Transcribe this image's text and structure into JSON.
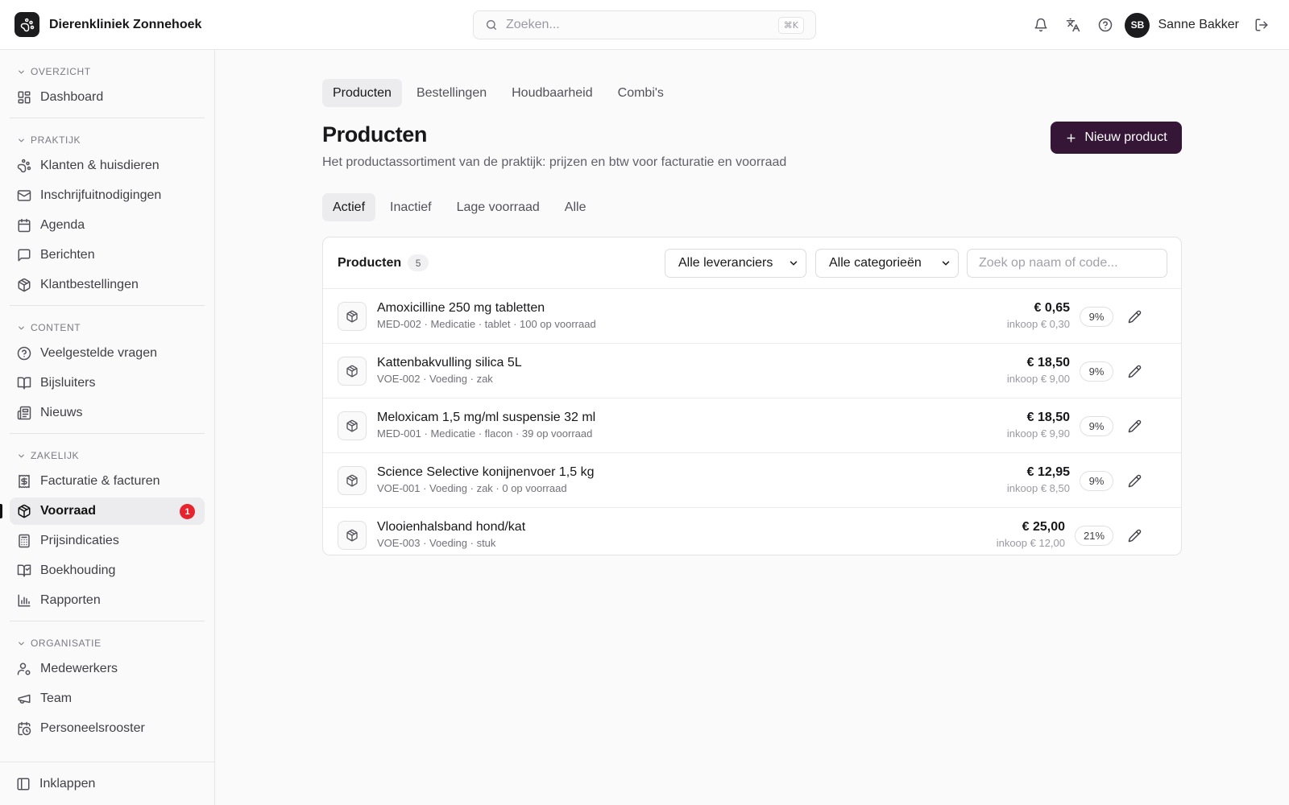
{
  "app": {
    "name": "Dierenkliniek Zonnehoek"
  },
  "search": {
    "placeholder": "Zoeken...",
    "shortcut": "⌘K"
  },
  "user": {
    "initials": "SB",
    "name": "Sanne Bakker"
  },
  "sidebar": {
    "sections": [
      {
        "heading": "OVERZICHT",
        "items": [
          {
            "label": "Dashboard",
            "icon": "dashboard-icon"
          }
        ]
      },
      {
        "heading": "PRAKTIJK",
        "items": [
          {
            "label": "Klanten & huisdieren",
            "icon": "paw-icon"
          },
          {
            "label": "Inschrijfuitnodigingen",
            "icon": "mail-icon"
          },
          {
            "label": "Agenda",
            "icon": "calendar-icon"
          },
          {
            "label": "Berichten",
            "icon": "message-icon"
          },
          {
            "label": "Klantbestellingen",
            "icon": "package-icon"
          }
        ]
      },
      {
        "heading": "CONTENT",
        "items": [
          {
            "label": "Veelgestelde vragen",
            "icon": "help-circle-icon"
          },
          {
            "label": "Bijsluiters",
            "icon": "book-open-icon"
          },
          {
            "label": "Nieuws",
            "icon": "newspaper-icon"
          }
        ]
      },
      {
        "heading": "ZAKELIJK",
        "items": [
          {
            "label": "Facturatie & facturen",
            "icon": "receipt-icon"
          },
          {
            "label": "Voorraad",
            "icon": "package-icon",
            "active": true,
            "badge": "1"
          },
          {
            "label": "Prijsindicaties",
            "icon": "calculator-icon"
          },
          {
            "label": "Boekhouding",
            "icon": "ledger-icon"
          },
          {
            "label": "Rapporten",
            "icon": "bar-chart-icon"
          }
        ]
      },
      {
        "heading": "ORGANISATIE",
        "items": [
          {
            "label": "Medewerkers",
            "icon": "user-cog-icon"
          },
          {
            "label": "Team",
            "icon": "megaphone-icon"
          },
          {
            "label": "Personeelsrooster",
            "icon": "calendar-clock-icon"
          }
        ]
      }
    ],
    "collapse_label": "Inklappen"
  },
  "tabs": [
    "Producten",
    "Bestellingen",
    "Houdbaarheid",
    "Combi's"
  ],
  "page": {
    "title": "Producten",
    "subtitle": "Het productassortiment van de praktijk: prijzen en btw voor facturatie en voorraad",
    "new_button": "Nieuw product"
  },
  "filter_tabs": [
    "Actief",
    "Inactief",
    "Lage voorraad",
    "Alle"
  ],
  "card": {
    "title": "Producten",
    "count": "5",
    "supplier_select": "Alle leveranciers",
    "category_select": "Alle categorieën",
    "search_placeholder": "Zoek op naam of code..."
  },
  "products": [
    {
      "name": "Amoxicilline 250 mg tabletten",
      "meta": "MED-002 · Medicatie · tablet · 100 op voorraad",
      "price": "€ 0,65",
      "cost": "inkoop € 0,30",
      "vat": "9%"
    },
    {
      "name": "Kattenbakvulling silica 5L",
      "meta": "VOE-002 · Voeding · zak",
      "price": "€ 18,50",
      "cost": "inkoop € 9,00",
      "vat": "9%"
    },
    {
      "name": "Meloxicam 1,5 mg/ml suspensie 32 ml",
      "meta": "MED-001 · Medicatie · flacon · 39 op voorraad",
      "price": "€ 18,50",
      "cost": "inkoop € 9,90",
      "vat": "9%"
    },
    {
      "name": "Science Selective konijnenvoer 1,5 kg",
      "meta": "VOE-001 · Voeding · zak · 0 op voorraad",
      "price": "€ 12,95",
      "cost": "inkoop € 8,50",
      "vat": "9%"
    },
    {
      "name": "Vlooienhalsband hond/kat",
      "meta": "VOE-003 · Voeding · stuk",
      "price": "€ 25,00",
      "cost": "inkoop € 12,00",
      "vat": "21%"
    }
  ],
  "colors": {
    "primary_button": "#351637",
    "badge": "#e5242d"
  }
}
